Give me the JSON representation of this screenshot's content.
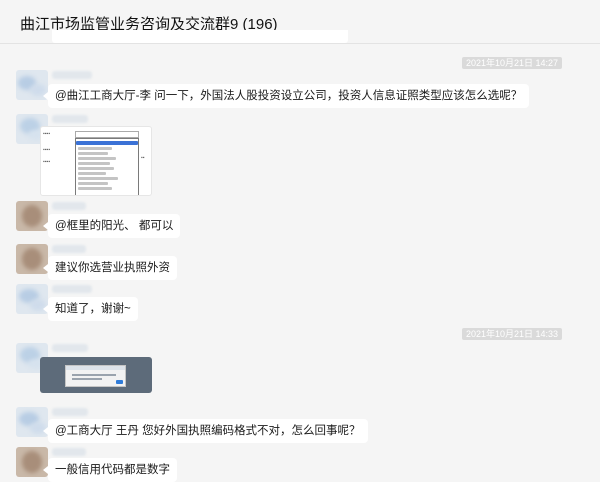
{
  "window": {
    "title": "曲江市场监管业务咨询及交流群9 (196)"
  },
  "timestamps": [
    "2021年10月21日 14:27",
    "2021年10月21日 14:33"
  ],
  "messages": [
    {
      "kind": "text",
      "text": "@曲江工商大厅-李 问一下，外国法人股投资设立公司，投资人信息证照类型应该怎么选呢？"
    },
    {
      "kind": "image",
      "icon": "form-dropdown-screenshot"
    },
    {
      "kind": "text",
      "text": "@框里的阳光、 都可以"
    },
    {
      "kind": "text",
      "text": "建议你选营业执照外资"
    },
    {
      "kind": "text",
      "text": "知道了，谢谢~"
    },
    {
      "kind": "image",
      "icon": "error-dialog-screenshot"
    },
    {
      "kind": "text",
      "text": "@工商大厅 王丹 您好外国执照编码格式不对，怎么回事呢？"
    },
    {
      "kind": "text",
      "text": "一般信用代码都是数字"
    }
  ],
  "colors": {
    "background": "#f5f5f5",
    "bubble": "#ffffff",
    "timestamp_bg": "#dadada"
  }
}
